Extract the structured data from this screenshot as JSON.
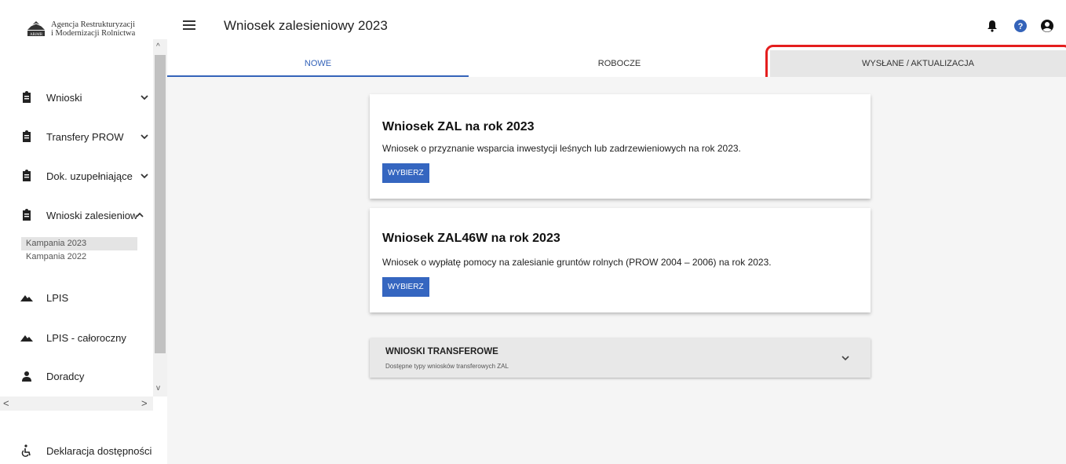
{
  "app": {
    "logo_line1": "Agencja Restrukturyzacji",
    "logo_line2": "i Modernizacji Rolnictwa",
    "title": "Wniosek zalesieniowy 2023"
  },
  "sidebar": {
    "items": [
      {
        "label": "Wnioski",
        "icon": "clipboard-icon"
      },
      {
        "label": "Transfery PROW",
        "icon": "clipboard-icon"
      },
      {
        "label": "Dok. uzupełniające",
        "icon": "clipboard-icon"
      },
      {
        "label": "Wnioski zalesieniowe",
        "icon": "clipboard-icon"
      },
      {
        "label": "LPIS",
        "icon": "mountain-icon"
      },
      {
        "label": "LPIS - całoroczny",
        "icon": "mountain-icon"
      },
      {
        "label": "Doradcy",
        "icon": "person-icon"
      }
    ],
    "subitems": [
      "Kampania 2023",
      "Kampania 2022"
    ],
    "accessibility": "Deklaracja dostępności"
  },
  "header": {
    "icons": [
      "bell-icon",
      "help-icon",
      "account-icon"
    ]
  },
  "tabs": [
    "NOWE",
    "ROBOCZE",
    "WYSŁANE / AKTUALIZACJA"
  ],
  "cards": [
    {
      "title": "Wniosek ZAL na rok 2023",
      "description": "Wniosek o przyznanie wsparcia inwestycji leśnych lub zadrzewieniowych na rok 2023.",
      "button": "WYBIERZ"
    },
    {
      "title": "Wniosek ZAL46W na rok 2023",
      "description": "Wniosek o wypłatę pomocy na zalesianie gruntów rolnych (PROW 2004 – 2006) na rok 2023.",
      "button": "WYBIERZ"
    }
  ],
  "accordion": {
    "title": "WNIOSKI TRANSFEROWE",
    "subtitle": "Dostępne typy wniosków transferowych ZAL"
  },
  "colors": {
    "accent": "#3463b9",
    "button": "#3566c0",
    "highlight": "#e41e1e"
  }
}
